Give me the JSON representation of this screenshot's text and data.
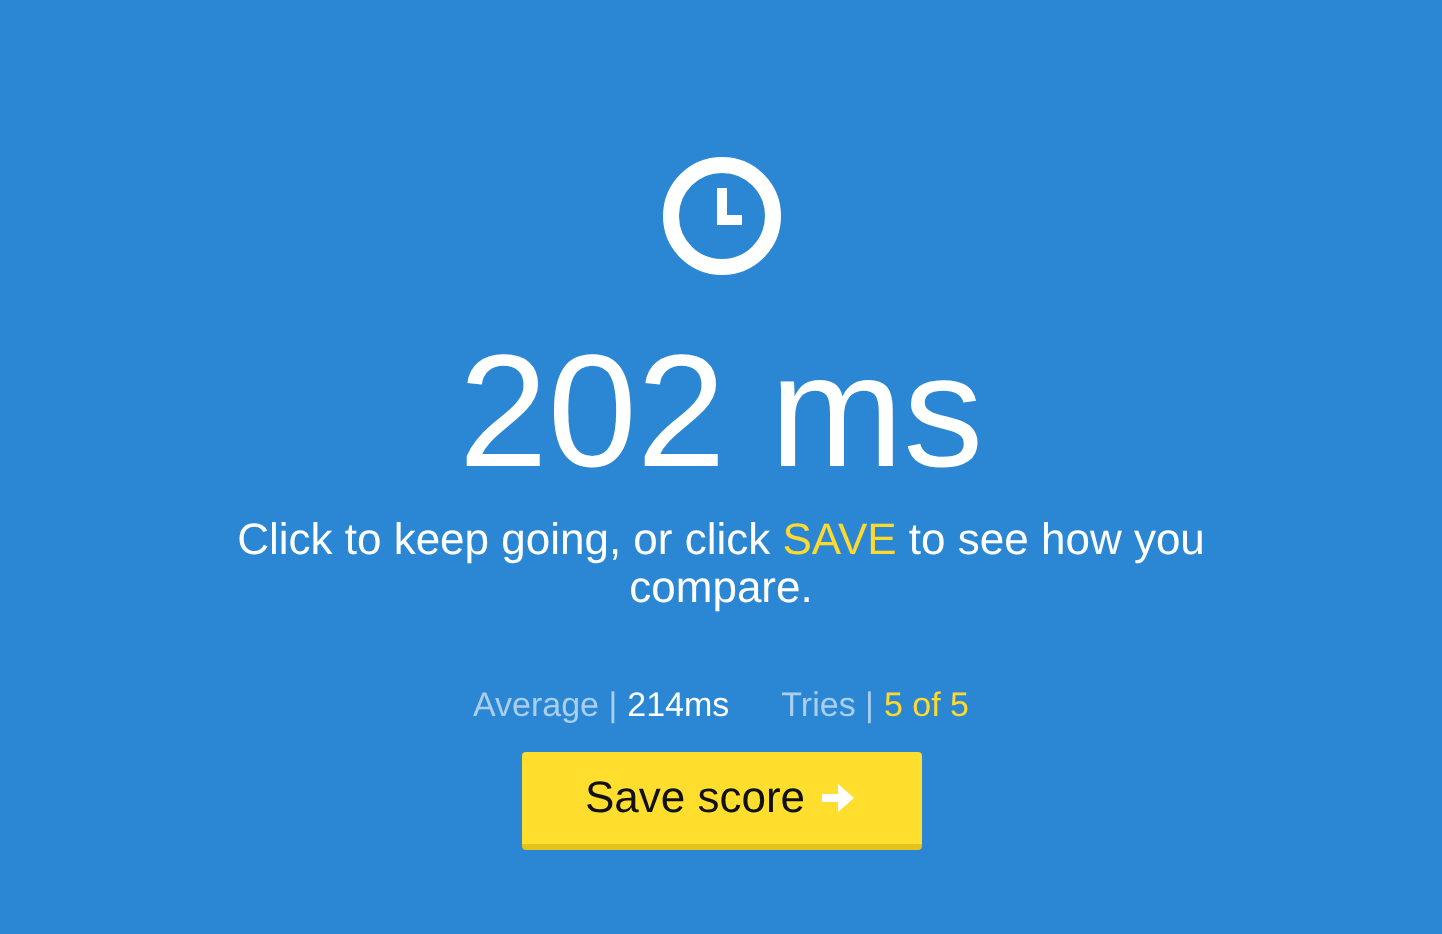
{
  "result": "202 ms",
  "message": [
    {
      "text": "Click to keep going, or click ",
      "highlight": false
    },
    {
      "text": "SAVE",
      "highlight": true
    },
    {
      "text": " to see how you compare.",
      "highlight": false
    }
  ],
  "stats": [
    {
      "label": "Average |",
      "value": "214ms",
      "highlight": false
    },
    {
      "label": "Tries |",
      "value": "5 of 5",
      "highlight": true
    }
  ],
  "button": {
    "label": "Save score"
  }
}
